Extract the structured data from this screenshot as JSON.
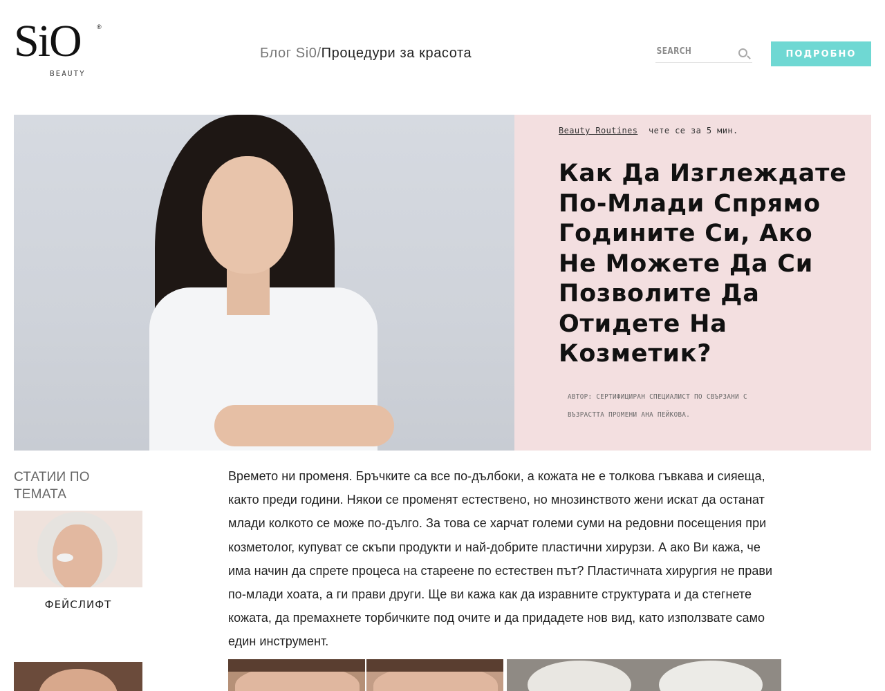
{
  "header": {
    "logo": {
      "mark": "SiO",
      "registered": "®",
      "subtitle": "BEAUTY"
    },
    "breadcrumb": {
      "home": "Блог Si0/",
      "current": "Процедури за красота"
    },
    "search": {
      "placeholder": "SEARCH",
      "value": "",
      "icon": "search-icon"
    },
    "more_button": "ПОДРОБНО"
  },
  "hero": {
    "category": "Beauty Routines",
    "read_time": "чете се за 5 мин.",
    "title": "Как Да Изглеждате По-Млади Спрямо Годините Си, Ако Не Можете Да Си Позволите Да Отидете На Козметик?",
    "author": "Автор: Сертифициран специалист по свързани с възрастта промени Ана Пейкова."
  },
  "sidebar": {
    "title": "СТАТИИ ПО ТЕМАТА",
    "cards": [
      {
        "label": "ФЕЙСЛИФТ"
      }
    ]
  },
  "article": {
    "intro": "Времето ни променя. Бръчките са все по-дълбоки, а кожата не е толкова гъвкава и сияеща, както преди години. Някои се променят естествено, но мнозинството жени искат да останат млади колкото се може по-дълго. За това се харчат големи суми на редовни посещения при козметолог, купуват се скъпи продукти и най-добрите пластични хирурзи. А ако Ви кажа, че има начин да спрете процеса на стареене по естествен път? Пластичната хирургия не прави по-млади хоата, а ги прави други. Ще ви кажа как да изравните структурата и да стегнете кожата, да премахнете торбичките под очите и да придадете нов вид, като използвате само един инструмент."
  },
  "colors": {
    "accent": "#6fd8d3",
    "hero_panel": "#f3dfe0"
  }
}
